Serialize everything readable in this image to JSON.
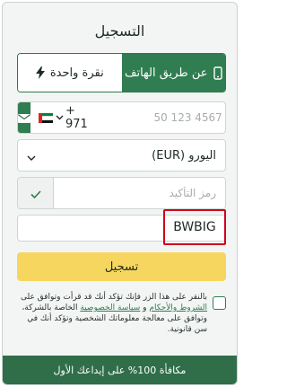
{
  "form": {
    "title": "التسجيل",
    "tabs": [
      {
        "label": "عن طريق الهاتف",
        "icon": "phone-icon",
        "active": true
      },
      {
        "label": "نقرة واحدة",
        "icon": "lightning-icon",
        "active": false
      }
    ],
    "phone": {
      "country_flag": "uae-flag-icon",
      "dial_code": "+ 971",
      "placeholder": "50 123 4567"
    },
    "currency": {
      "value": "اليورو (EUR)"
    },
    "promo": {
      "placeholder": "رمز التأكيد"
    },
    "code": {
      "value": "BWBIG"
    },
    "submit_label": "تسجيل",
    "terms": {
      "prefix": "بالنقر على هذا الزر فإنك تؤكد أنك قد قرأت وتوافق على ",
      "terms_link": "الشروط والأحكام",
      "and": " و ",
      "privacy_link": "سياسة الخصوصية",
      "suffix": " الخاصة بالشركة، وتوافق على معالجة معلوماتك الشخصية وتؤكد أنك في سن قانونية."
    },
    "bonus": "مكافأة 100% على إيداعك الأول"
  },
  "colors": {
    "brand_green": "#2f7d50",
    "submit_yellow": "#f6d65f",
    "highlight_red": "#d0021b"
  }
}
